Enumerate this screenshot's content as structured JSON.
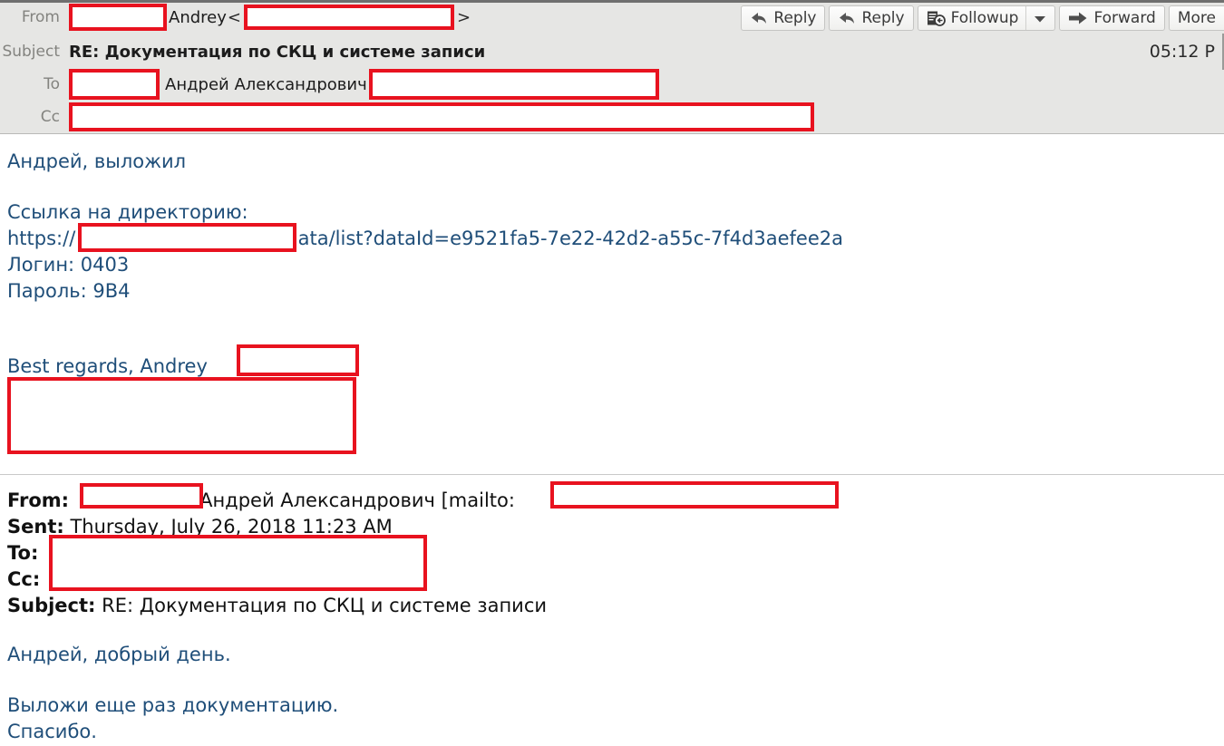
{
  "toolbar": {
    "buttons": [
      {
        "label": "Reply",
        "icon": "reply-arrow-icon",
        "has_dropdown": false
      },
      {
        "label": "Reply",
        "icon": "reply-all-arrow-icon",
        "has_dropdown": false
      },
      {
        "label": "Followup",
        "icon": "followup-flag-icon",
        "has_dropdown": true
      },
      {
        "label": "Forward",
        "icon": "forward-arrow-icon",
        "has_dropdown": false
      },
      {
        "label": "More",
        "icon": "more-icon",
        "has_dropdown": false
      }
    ]
  },
  "header": {
    "labels": {
      "from": "From",
      "subject": "Subject",
      "to": "To",
      "cc": "Cc"
    },
    "from": {
      "display_name": "Andrey",
      "angle_open": "<",
      "angle_close": ">",
      "name_redacted": true,
      "email_redacted": true
    },
    "subject": "RE: Документация по СКЦ и системе записи",
    "to": {
      "display_name": "Андрей Александрович",
      "prefix_redacted": true,
      "email_redacted": true
    },
    "cc": {
      "value_redacted": true
    },
    "timestamp": "05:12 P"
  },
  "message_body": {
    "greeting": "Андрей, выложил",
    "link_label": "Ссылка на директорию:",
    "url_prefix": "https://",
    "url_suffix": "data/list?dataId=e9521fa5-7e22-42d2-a55c-7f4d3aefee2a",
    "login_line": "Логин: 0403",
    "password_line": "Пароль: 9В4",
    "signature": "Best regards, Andrey"
  },
  "quoted_header": {
    "from_label": "From:",
    "from_name": "Андрей Александрович [mailto:",
    "sent_label": "Sent:",
    "sent_value": "Thursday, July 26, 2018 11:23 AM",
    "to_label": "To:",
    "cc_label": "Cc:",
    "subject_label": "Subject:",
    "subject_value": "RE: Документация по СКЦ и системе записи"
  },
  "quoted_body": {
    "greeting": "Андрей, добрый день.",
    "line1": "Выложи еще раз документацию.",
    "line2": "Спасибо."
  },
  "colors": {
    "redaction_border": "#e8121f",
    "body_text": "#1f4e79",
    "header_bg": "#e6e6e4",
    "label_text": "#83837f"
  }
}
